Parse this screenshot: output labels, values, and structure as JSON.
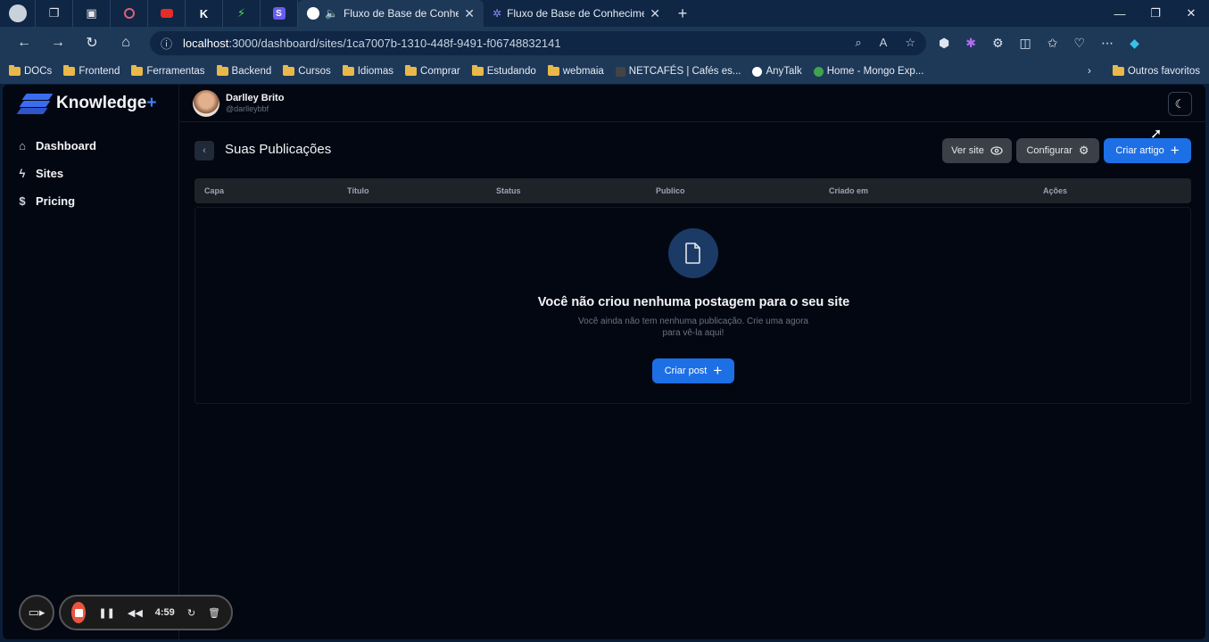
{
  "browser": {
    "tabs": [
      {
        "title": "Fluxo de Base de Conhecimen",
        "active": true
      },
      {
        "title": "Fluxo de Base de Conhecimento",
        "active": false
      }
    ],
    "url": {
      "host": "localhost",
      "path": ":3000/dashboard/sites/1ca7007b-1310-448f-9491-f06748832141"
    },
    "bookmarks": [
      "DOCs",
      "Frontend",
      "Ferramentas",
      "Backend",
      "Cursos",
      "Idiomas",
      "Comprar",
      "Estudando",
      "webmaia",
      "NETCAFÉS | Cafés es...",
      "AnyTalk",
      "Home - Mongo Exp..."
    ],
    "other_bookmarks": "Outros favoritos"
  },
  "app": {
    "logo": {
      "name": "Knowledge",
      "plus": "+"
    },
    "sidebar": [
      {
        "label": "Dashboard",
        "icon": "home-icon"
      },
      {
        "label": "Sites",
        "icon": "activity-icon"
      },
      {
        "label": "Pricing",
        "icon": "dollar-icon"
      }
    ],
    "user": {
      "name": "Darlley Brito",
      "handle": "@darlleybbf"
    },
    "page_title": "Suas Publicações",
    "actions": {
      "view_site": "Ver site",
      "configure": "Configurar",
      "create_article": "Criar artigo"
    },
    "table_headers": [
      "Capa",
      "Título",
      "Status",
      "Publico",
      "Criado em",
      "Ações"
    ],
    "empty_state": {
      "title": "Você não criou nenhuma postagem para o seu site",
      "subtitle": "Você ainda não tem nenhuma publicação. Crie uma agora para vê-la aqui!",
      "button": "Criar post"
    }
  },
  "recorder": {
    "time": "4:59"
  },
  "colors": {
    "accent": "#1d6fe6",
    "background": "#030712",
    "browser_chrome": "#1e3858"
  }
}
